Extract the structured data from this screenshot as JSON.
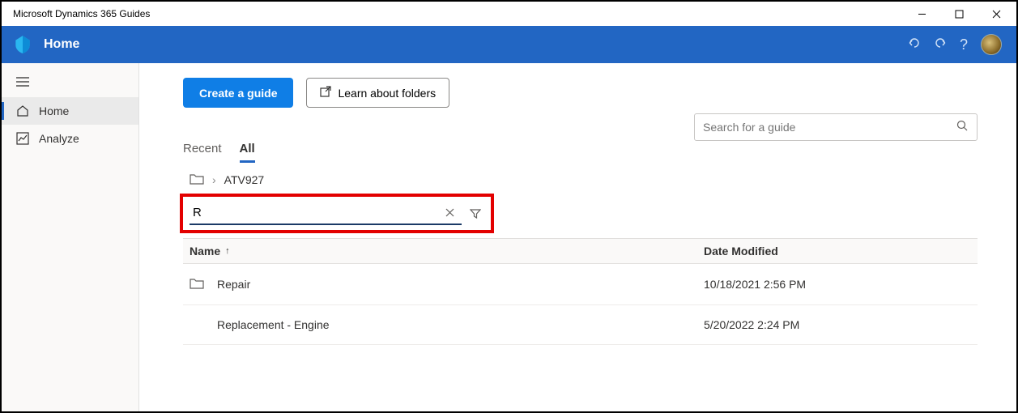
{
  "titlebar": {
    "title": "Microsoft Dynamics 365 Guides"
  },
  "header": {
    "title": "Home"
  },
  "sidebar": {
    "items": [
      {
        "label": "Home"
      },
      {
        "label": "Analyze"
      }
    ]
  },
  "actions": {
    "create_label": "Create a guide",
    "learn_label": "Learn about folders"
  },
  "search": {
    "placeholder": "Search for a guide"
  },
  "tabs": {
    "recent": "Recent",
    "all": "All"
  },
  "breadcrumb": {
    "current": "ATV927"
  },
  "filter": {
    "value": "R"
  },
  "table": {
    "head": {
      "name": "Name",
      "date": "Date Modified"
    },
    "rows": [
      {
        "name": "Repair",
        "date": "10/18/2021 2:56 PM",
        "is_folder": true
      },
      {
        "name": "Replacement - Engine",
        "date": "5/20/2022 2:24 PM",
        "is_folder": false
      }
    ]
  }
}
